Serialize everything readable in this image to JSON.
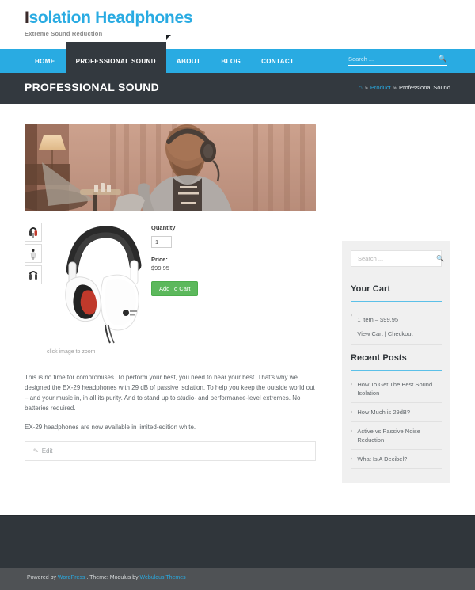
{
  "site": {
    "brand_lead": "I",
    "brand_rest": "solation Headphones",
    "tagline": "Extreme Sound Reduction",
    "accent_color": "#29abe2",
    "dark_color": "#33393f"
  },
  "header_search": {
    "placeholder": "Search ...",
    "value": "",
    "icon": "search-icon"
  },
  "nav": {
    "items": [
      {
        "label": "HOME",
        "active": false
      },
      {
        "label": "PROFESSIONAL SOUND",
        "active": true
      },
      {
        "label": "ABOUT",
        "active": false
      },
      {
        "label": "BLOG",
        "active": false
      },
      {
        "label": "CONTACT",
        "active": false
      }
    ]
  },
  "titlebar": {
    "title": "PROFESSIONAL SOUND",
    "breadcrumb": {
      "home_icon": "home-icon",
      "sep": "»",
      "link": "Product",
      "current": "Professional Sound"
    }
  },
  "product": {
    "zoom_caption": "click image to zoom",
    "quantity_label": "Quantity",
    "quantity_value": "1",
    "price_label": "Price:",
    "price_value": "$99.95",
    "add_to_cart": "Add To Cart",
    "thumbnails": [
      "headphone-thumb-1",
      "headphone-thumb-2",
      "headphone-thumb-3"
    ],
    "description_1": "This is no time for compromises. To perform your best, you need to hear your best. That's why we designed the EX-29 headphones with 29 dB of passive isolation. To help you keep the outside world out – and your music in, in all its purity. And to stand up to studio- and performance-level extremes. No batteries required.",
    "description_2": "EX-29 headphones are now available in limited-edition white.",
    "edit_label": "Edit"
  },
  "sidebar": {
    "search": {
      "placeholder": "Search ...",
      "value": "",
      "icon": "search-icon"
    },
    "cart": {
      "title": "Your Cart",
      "summary": "1 item – $99.95",
      "links": "View Cart | Checkout"
    },
    "recent_posts": {
      "title": "Recent Posts",
      "items": [
        "How To Get The Best Sound Isolation",
        "How Much is 29dB?",
        "Active vs Passive Noise Reduction",
        "What Is A Decibel?"
      ]
    }
  },
  "footer": {
    "powered_by": "Powered by ",
    "wordpress": "WordPress",
    "theme_text": " . Theme: Modulus by ",
    "theme_author": "Webulous Themes"
  }
}
